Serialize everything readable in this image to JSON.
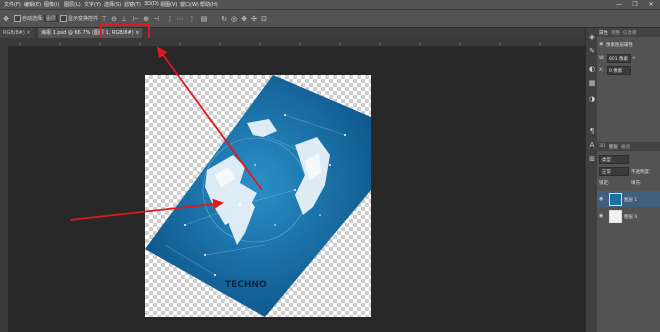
{
  "menubar": {
    "items": [
      "文件(F)",
      "编辑(E)",
      "图像(I)",
      "图层(L)",
      "文字(Y)",
      "选择(S)",
      "滤镜(T)",
      "3D(D)",
      "视图(V)",
      "窗口(W)",
      "帮助(H)"
    ],
    "min": "—",
    "max": "❐",
    "close": "✕"
  },
  "options": {
    "auto_select": "自动选择:",
    "layer_select": "图层",
    "show_transform": "显示变换控件"
  },
  "tabs": {
    "prev": "RGB/8#)",
    "prev_close": "×",
    "active": "海报 1.psd @ 66.7% (图层 1, RGB/8#)",
    "active_close": "×"
  },
  "poster": {
    "headline": "TECHNO",
    "colors": {
      "bg": "#1a6fa3",
      "dark": "#0e4f7c",
      "globe": "#e9f2f9"
    }
  },
  "annotation": {
    "color": "#e0191e"
  },
  "panel": {
    "tab_properties": "属性",
    "tab_adjust": "调整",
    "tab_info": "信息库",
    "prop_title": "像素图层属性",
    "w_label": "W:",
    "w_value": "801 像素",
    "h_label": "H:",
    "h_value": "1000 像素",
    "x_label": "X:",
    "x_value": "0 像素",
    "y_label": "Y:",
    "y_value": "0 像素",
    "layers_tabs": [
      "3D",
      "图层",
      "通道"
    ],
    "kind": "类型",
    "mode": "正常",
    "opacity_label": "不透明度:",
    "lock_label": "锁定:",
    "fill_label": "填充:",
    "layers": [
      {
        "name": "图层 1"
      },
      {
        "name": "图层 0"
      }
    ]
  }
}
